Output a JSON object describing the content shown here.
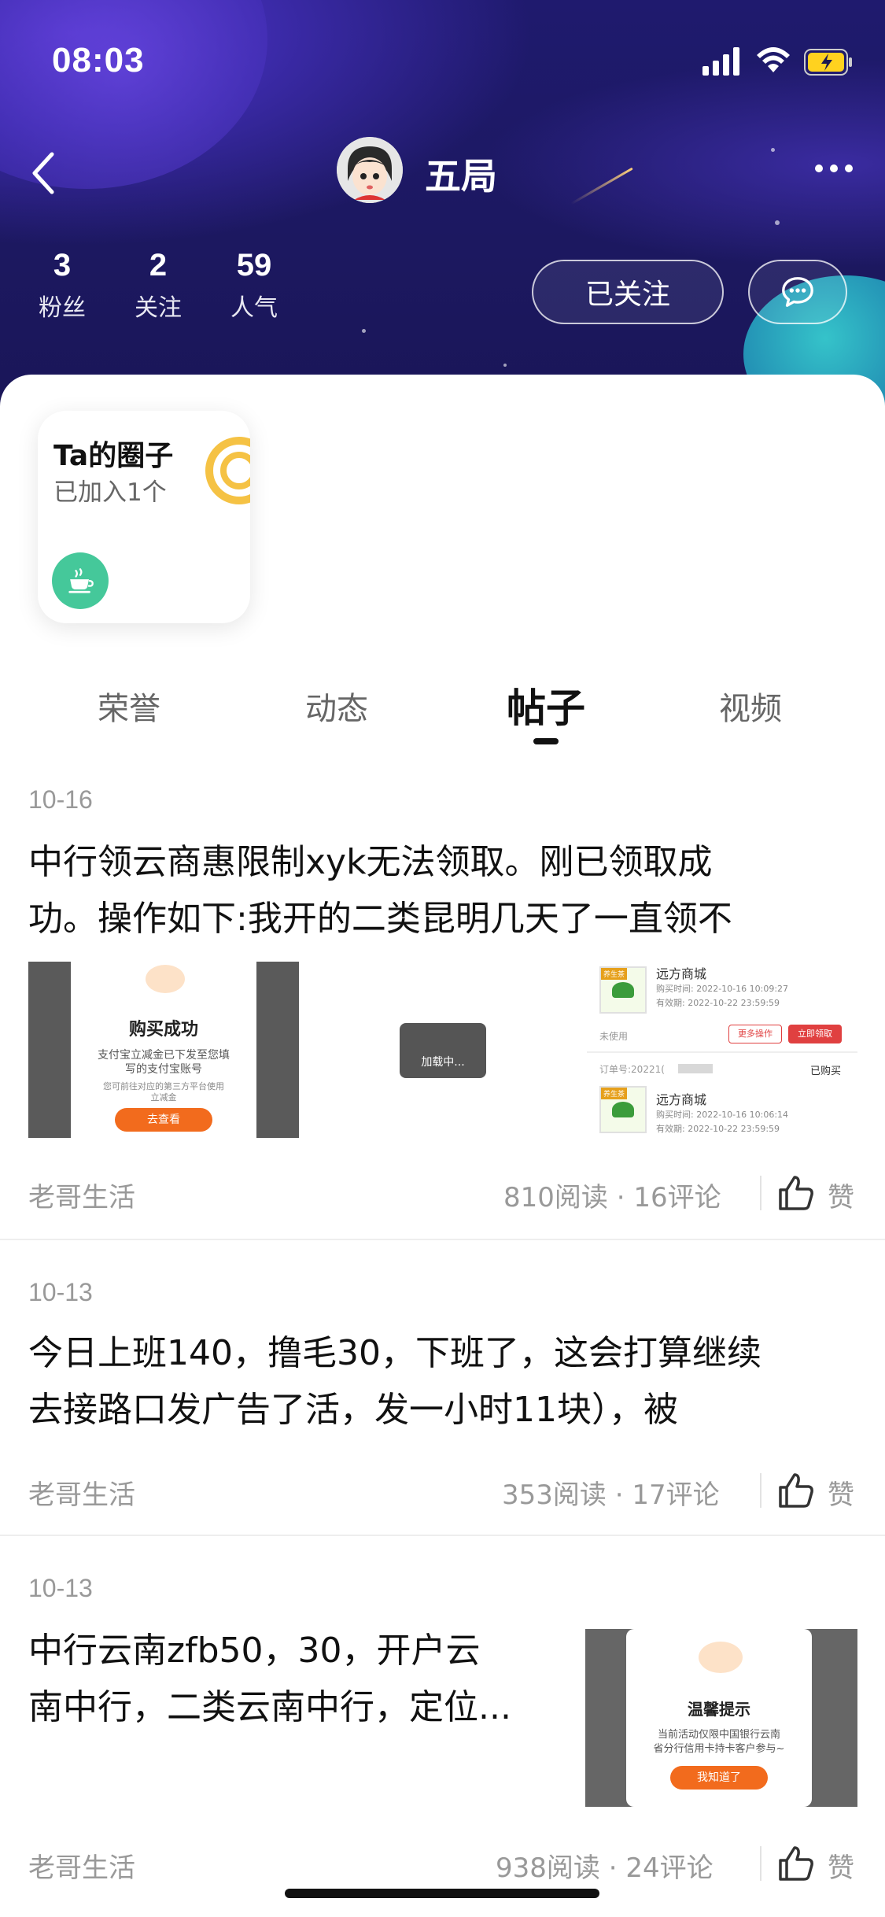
{
  "status_bar": {
    "time": "08:03"
  },
  "profile": {
    "username": "五局",
    "stats": [
      {
        "value": "3",
        "label": "粉丝"
      },
      {
        "value": "2",
        "label": "关注"
      },
      {
        "value": "59",
        "label": "人气"
      }
    ],
    "follow_label": "已关注"
  },
  "circle_card": {
    "title": "Ta的圈子",
    "subtitle": "已加入1个"
  },
  "tabs": [
    {
      "label": "荣誉",
      "active": false
    },
    {
      "label": "动态",
      "active": false
    },
    {
      "label": "帖子",
      "active": true
    },
    {
      "label": "视频",
      "active": false
    }
  ],
  "posts": [
    {
      "date": "10-16",
      "lines": [
        "中行领云商惠限制xyk无法领取。刚已领取成",
        "功。操作如下:我开的二类昆明几天了一直领不"
      ],
      "author": "老哥生活",
      "reads": "810阅读 · 16评论",
      "like": "赞",
      "image1": {
        "title": "购买成功",
        "text1": "支付宝立减金已下发至您填",
        "text2": "写的支付宝账号",
        "text3": "您可前往对应的第三方平台使用",
        "text4": "立减金",
        "button": "去查看"
      },
      "image2": {
        "text": "加载中..."
      },
      "image3": {
        "shop1": "远方商城",
        "time1": "购买时间: 2022-10-16 10:09:27",
        "exp1": "有效期: 2022-10-22 23:59:59",
        "status": "未使用",
        "btn_more": "更多操作",
        "btn_claim": "立即领取",
        "order": "订单号:20221(",
        "bought": "已购买",
        "shop2": "远方商城",
        "time2": "购买时间: 2022-10-16 10:06:14",
        "exp2": "有效期: 2022-10-22 23:59:59",
        "badge": "养生茶"
      }
    },
    {
      "date": "10-13",
      "lines": [
        "今日上班140，撸毛30，下班了，这会打算继续",
        "去接路口发广告了活，发一小时11块），被"
      ],
      "author": "老哥生活",
      "reads": "353阅读 · 17评论",
      "like": "赞"
    },
    {
      "date": "10-13",
      "lines": [
        "中行云南zfb50，30，开户云",
        "南中行，二类云南中行，定位..."
      ],
      "author": "老哥生活",
      "reads": "938阅读 · 24评论",
      "like": "赞",
      "image": {
        "title": "温馨提示",
        "text1": "当前活动仅限中国银行云南",
        "text2": "省分行信用卡持卡客户参与~",
        "button": "我知道了"
      }
    }
  ],
  "colors": {
    "header_bg": "#1f1a6e",
    "accent_orange": "#f26b1d",
    "cup_green": "#45c89a"
  }
}
